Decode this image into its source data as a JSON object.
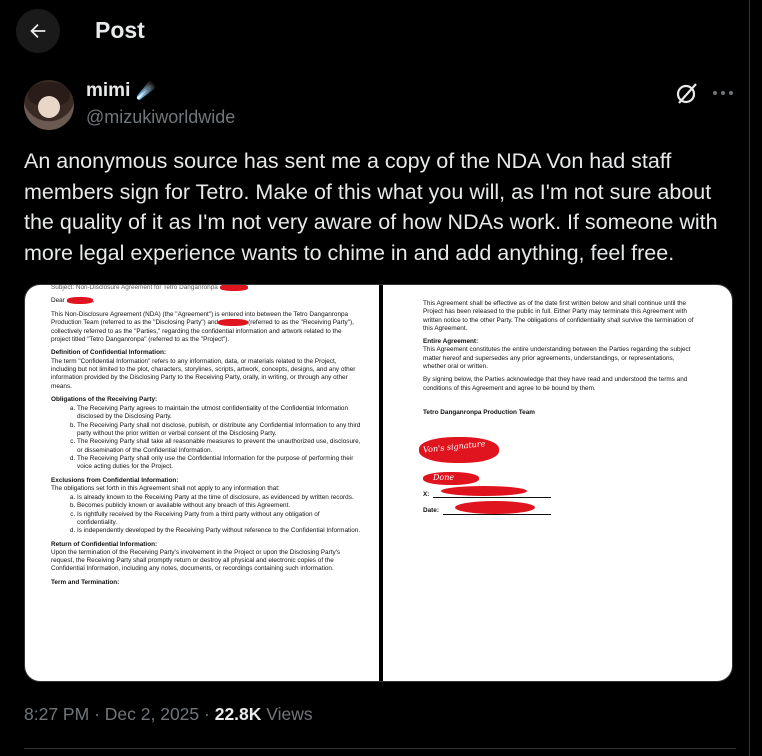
{
  "header": {
    "title": "Post"
  },
  "author": {
    "name": "mimi",
    "handle": "@mizukiworldwide",
    "badge_emoji": "☄️"
  },
  "tweet": {
    "text": "An anonymous source has sent me a copy of the NDA Von had staff members sign for Tetro. Make of this what you will, as I'm not sure about the quality of it as I'm not very aware of how NDAs work. If someone with more legal experience wants to chime in and add anything, feel free."
  },
  "document_left": {
    "subject_line": "Subject: Non-Disclosure Agreement for Tetro Danganronpa",
    "dear": "Dear",
    "intro_a": "This Non-Disclosure Agreement (NDA) (the \"Agreement\") is entered into between the Tetro Danganronpa Production Team (referred to as the \"Disclosing Party\") and",
    "intro_b": "(referred to as the \"Receiving Party\"), collectively referred to as the \"Parties,\" regarding the confidential information and artwork related to the project titled \"Tetro Danganronpa\" (referred to as the \"Project\").",
    "def_heading": "Definition of Confidential Information:",
    "def_text": "The term \"Confidential Information\" refers to any information, data, or materials related to the Project, including but not limited to the plot, characters, storylines, scripts, artwork, concepts, designs, and any other information provided by the Disclosing Party to the Receiving Party, orally, in writing, or through any other means.",
    "obl_heading": "Obligations of the Receiving Party:",
    "obligations": [
      "The Receiving Party agrees to maintain the utmost confidentiality of the Confidential Information disclosed by the Disclosing Party.",
      "The Receiving Party shall not disclose, publish, or distribute any Confidential Information to any third party without the prior written or verbal consent of the Disclosing Party.",
      "The Receiving Party shall take all reasonable measures to prevent the unauthorized use, disclosure, or dissemination of the Confidential Information.",
      "The Receiving Party shall only use the Confidential Information for the purpose of performing their voice acting duties for the Project."
    ],
    "excl_heading": "Exclusions from Confidential Information:",
    "excl_intro": "The obligations set forth in this Agreement shall not apply to any information that:",
    "exclusions": [
      "Is already known to the Receiving Party at the time of disclosure, as evidenced by written records.",
      "Becomes publicly known or available without any breach of this Agreement.",
      "Is rightfully received by the Receiving Party from a third party without any obligation of confidentiality.",
      "Is independently developed by the Receiving Party without reference to the Confidential Information."
    ],
    "return_heading": "Return of Confidential Information:",
    "return_text": "Upon the termination of the Receiving Party's involvement in the Project or upon the Disclosing Party's request, the Receiving Party shall promptly return or destroy all physical and electronic copies of the Confidential Information, including any notes, documents, or recordings containing such information.",
    "term_heading": "Term and Termination:"
  },
  "document_right": {
    "term_text": "This Agreement shall be effective as of the date first written below and shall continue until the Project has been released to the public in full. Either Party may terminate this Agreement with written notice to the other Party. The obligations of confidentiality shall survive the termination of this Agreement.",
    "entire_heading": "Entire Agreement:",
    "entire_text": "This Agreement constitutes the entire understanding between the Parties regarding the subject matter hereof and supersedes any prior agreements, understandings, or representations, whether oral or written.",
    "signing_text": "By signing below, the Parties acknowledge that they have read and understood the terms and conditions of this Agreement and agree to be bound by them.",
    "team_label": "Tetro Danganronpa Production Team",
    "sig_note_1": "Von's signature",
    "sig_note_2": "Done",
    "x_label": "X:",
    "date_label": "Date:"
  },
  "meta": {
    "time": "8:27 PM",
    "sep": "·",
    "date": "Dec 2, 2025",
    "views_count": "22.8K",
    "views_label": "Views"
  },
  "colors": {
    "background": "#000000",
    "text": "#e7e9ea",
    "muted": "#71767b",
    "redaction": "#e0141e"
  }
}
